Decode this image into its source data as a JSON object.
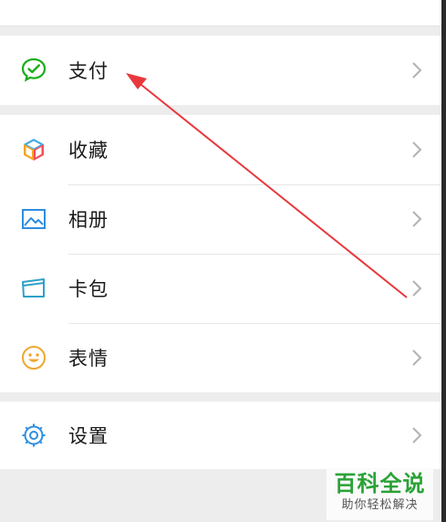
{
  "colors": {
    "accent_green": "#2aa236",
    "arrow_red": "#e8383d",
    "chevron": "#b2b2b2"
  },
  "groups": [
    {
      "items": [
        {
          "label": "支付",
          "icon": "wechat-pay-icon"
        }
      ]
    },
    {
      "items": [
        {
          "label": "收藏",
          "icon": "favorites-cube-icon"
        },
        {
          "label": "相册",
          "icon": "photo-album-icon"
        },
        {
          "label": "卡包",
          "icon": "card-wallet-icon"
        },
        {
          "label": "表情",
          "icon": "smiley-emoji-icon"
        }
      ]
    },
    {
      "items": [
        {
          "label": "设置",
          "icon": "gear-icon"
        }
      ]
    }
  ],
  "watermark": {
    "title": "百科全说",
    "subtitle": "助你轻松解决"
  }
}
